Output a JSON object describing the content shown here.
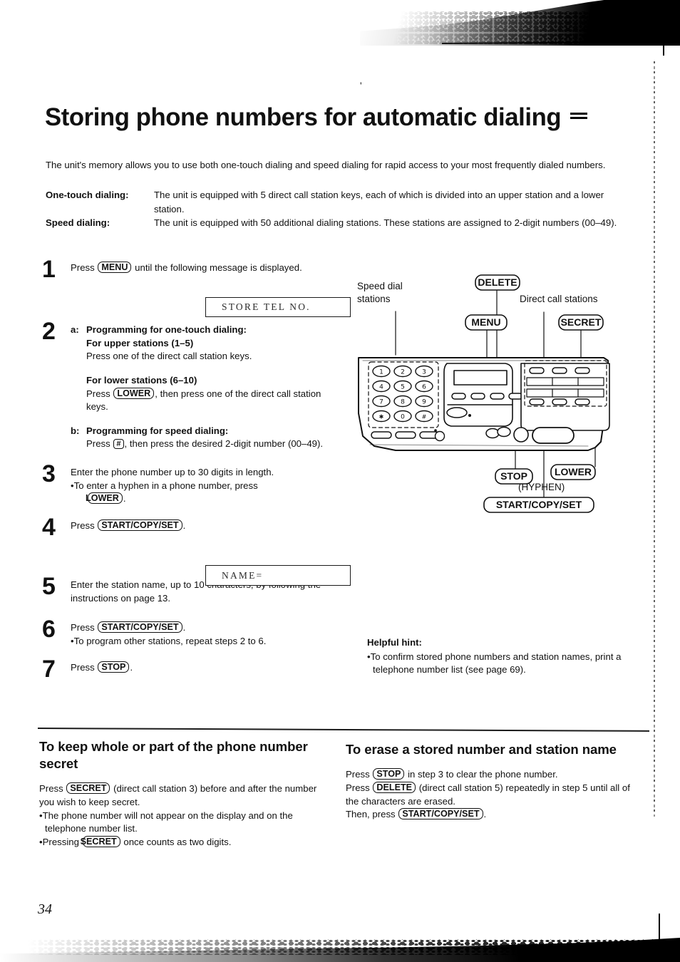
{
  "page": {
    "number": "34",
    "title": "Storing phone numbers for automatic dialing",
    "intro": "The unit's memory allows you to use both one-touch dialing and speed dialing for rapid access to your most frequently dialed numbers."
  },
  "definitions": [
    {
      "term": "One-touch dialing:",
      "desc": "The unit is equipped with 5 direct call station keys, each of which is divided into an upper station and a lower station."
    },
    {
      "term": "Speed dialing:",
      "desc": "The unit is equipped with 50 additional dialing stations. These stations are assigned to 2-digit numbers (00–49)."
    }
  ],
  "steps": [
    {
      "num": "1",
      "line_a": "Press",
      "key": "MENU",
      "line_b": "until the following message is displayed."
    },
    {
      "num": "2",
      "a_label": "a:",
      "a_head1": "Programming for one-touch dialing:",
      "a_head2": "For upper stations (1–5)",
      "a_text": "Press one of the direct call station keys.",
      "a_head3": "For lower stations (6–10)",
      "a_text2_pre": "Press",
      "a_key": "LOWER",
      "a_text2_post": ", then press one of the direct call station keys.",
      "b_label": "b:",
      "b_head": "Programming for speed dialing:",
      "b_text_pre": "Press",
      "b_key": "#",
      "b_text_post": ", then press the desired 2-digit number (00–49)."
    },
    {
      "num": "3",
      "line_a": "Enter the phone number up to 30 digits in length.",
      "bullet_pre": "To enter a hyphen in a phone number, press",
      "key": "LOWER",
      "bullet_post": "."
    },
    {
      "num": "4",
      "line_a": "Press",
      "key": "START/COPY/SET",
      "line_b": "."
    },
    {
      "num": "5",
      "line_a": "Enter the station name, up to 10 characters, by following the instructions on page 13."
    },
    {
      "num": "6",
      "line_a": "Press",
      "key": "START/COPY/SET",
      "line_b": ".",
      "bullet": "To program other stations, repeat steps 2 to 6."
    },
    {
      "num": "7",
      "line_a": "Press",
      "key": "STOP",
      "line_b": "."
    }
  ],
  "displays": {
    "store_tel": "STORE TEL NO.",
    "name": "NAME="
  },
  "diagram": {
    "callouts": {
      "speed_dial": "Speed dial\nstations",
      "delete": "DELETE",
      "menu": "MENU",
      "direct_call": "Direct call stations",
      "secret": "SECRET",
      "stop": "STOP",
      "lower": "LOWER",
      "hyphen": "(HYPHEN)",
      "start_copy_set": "START/COPY/SET"
    },
    "keypad": [
      "1",
      "2",
      "3",
      "4",
      "5",
      "6",
      "7",
      "8",
      "9",
      "✳",
      "0",
      "#"
    ]
  },
  "hint": {
    "heading": "Helpful hint:",
    "bullet": "To confirm stored phone numbers and station names, print a telephone number list (see page 69)."
  },
  "sections": [
    {
      "heading": "To keep whole or part of the phone number secret",
      "p1_pre": "Press",
      "p1_key": "SECRET",
      "p1_post": "(direct call station 3) before and after the number you wish to keep secret.",
      "b1": "The phone number will not appear on the display and on the telephone number list.",
      "b2_pre": "Pressing",
      "b2_key": "SECRET",
      "b2_post": "once counts as two digits."
    },
    {
      "heading": "To erase a stored number and station name",
      "l1_pre": "Press",
      "l1_key": "STOP",
      "l1_post": "in step 3 to clear the phone number.",
      "l2_pre": "Press",
      "l2_key": "DELETE",
      "l2_post": "(direct call station 5) repeatedly in step 5 until all of the characters are erased.",
      "l3_pre": "Then, press",
      "l3_key": "START/COPY/SET",
      "l3_post": "."
    }
  ],
  "colors": {
    "ink": "#111111",
    "paper": "#ffffff"
  }
}
